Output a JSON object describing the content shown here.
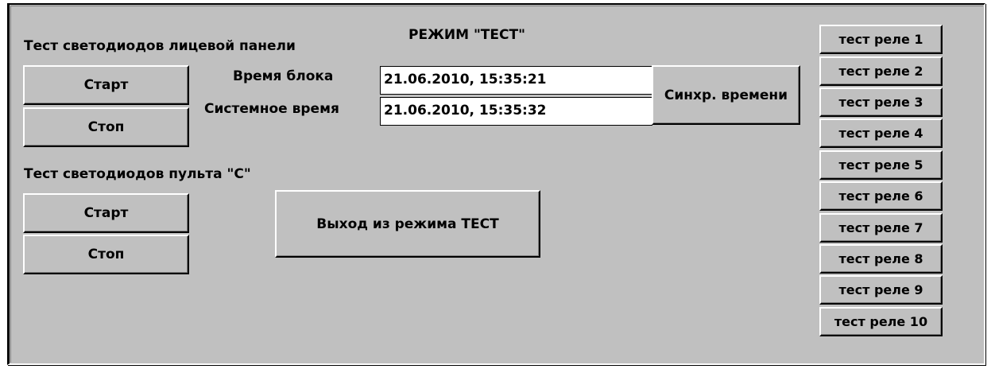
{
  "title": "РЕЖИМ \"ТЕСТ\"",
  "front_panel": {
    "label": "Тест светодиодов лицевой панели",
    "start_label": "Старт",
    "stop_label": "Стоп"
  },
  "remote_panel": {
    "label": "Тест светодиодов пульта \"С\"",
    "start_label": "Старт",
    "stop_label": "Стоп"
  },
  "time": {
    "block_label": "Время блока",
    "block_value": "21.06.2010, 15:35:21",
    "system_label": "Системное время",
    "system_value": "21.06.2010, 15:35:32",
    "sync_label": "Синхр. времени"
  },
  "exit_label": "Выход из режима ТЕСТ",
  "relays": [
    "тест реле 1",
    "тест реле 2",
    "тест реле 3",
    "тест реле 4",
    "тест реле 5",
    "тест реле 6",
    "тест реле 7",
    "тест реле 8",
    "тест реле 9",
    "тест реле 10"
  ]
}
